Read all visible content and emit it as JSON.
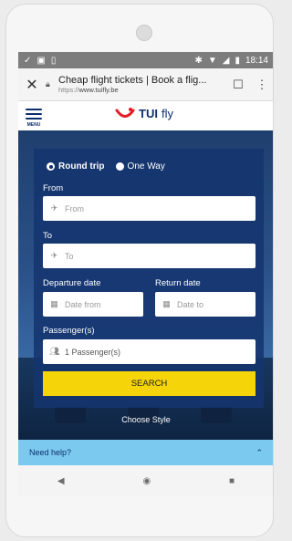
{
  "status_bar": {
    "time": "18:14",
    "left_icons": [
      "check-icon",
      "image-icon",
      "document-icon"
    ],
    "right_icons": [
      "bluetooth-icon",
      "wifi-icon",
      "signal-icon",
      "battery-icon"
    ]
  },
  "browser": {
    "page_title": "Cheap flight tickets | Book a flig...",
    "url_prefix": "https://",
    "url_host": "www.tuifly.be"
  },
  "site_header": {
    "menu_label": "MENU",
    "logo_brand": "TUI",
    "logo_suffix": "fly"
  },
  "search_form": {
    "trip_options": [
      "Round trip",
      "One Way"
    ],
    "selected_trip": "Round trip",
    "from_label": "From",
    "from_placeholder": "From",
    "to_label": "To",
    "to_placeholder": "To",
    "departure_label": "Departure date",
    "departure_placeholder": "Date from",
    "return_label": "Return date",
    "return_placeholder": "Date to",
    "passengers_label": "Passenger(s)",
    "passengers_value": "1 Passenger(s)",
    "search_button": "SEARCH"
  },
  "hero_caption": "Choose Style",
  "help_bar": {
    "label": "Need help?"
  },
  "colors": {
    "brand_blue": "#0b2e6b",
    "search_yellow": "#f5d40a",
    "help_bar": "#7cc9ef",
    "logo_red": "#e41e26"
  }
}
